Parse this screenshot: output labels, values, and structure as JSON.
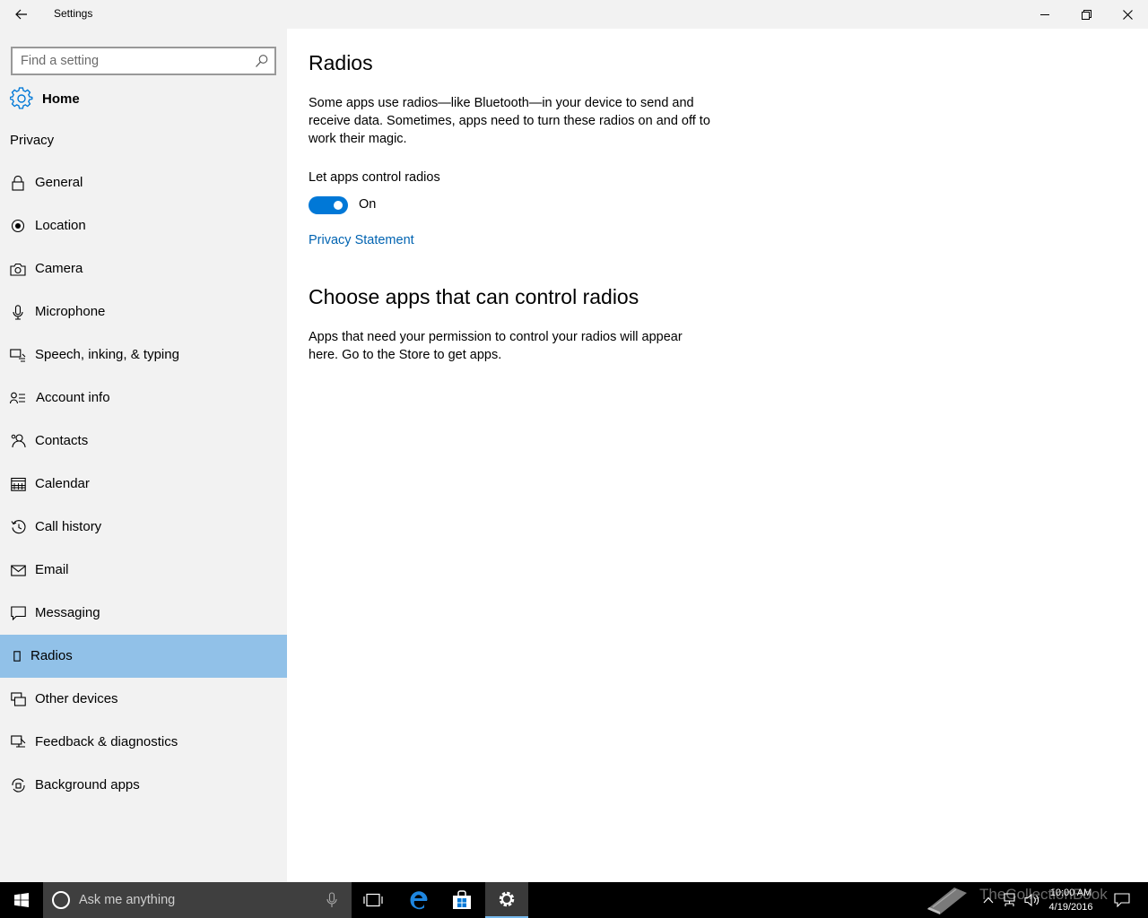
{
  "window": {
    "title": "Settings"
  },
  "sidebar": {
    "search_placeholder": "Find a setting",
    "home_label": "Home",
    "section": "Privacy",
    "items": [
      {
        "label": "General",
        "icon": "lock-icon"
      },
      {
        "label": "Location",
        "icon": "location-icon"
      },
      {
        "label": "Camera",
        "icon": "camera-icon"
      },
      {
        "label": "Microphone",
        "icon": "microphone-icon"
      },
      {
        "label": "Speech, inking, & typing",
        "icon": "speech-icon"
      },
      {
        "label": "Account info",
        "icon": "account-info-icon"
      },
      {
        "label": "Contacts",
        "icon": "contacts-icon"
      },
      {
        "label": "Calendar",
        "icon": "calendar-icon"
      },
      {
        "label": "Call history",
        "icon": "history-icon"
      },
      {
        "label": "Email",
        "icon": "email-icon"
      },
      {
        "label": "Messaging",
        "icon": "messaging-icon"
      },
      {
        "label": "Radios",
        "icon": "radios-icon",
        "selected": true
      },
      {
        "label": "Other devices",
        "icon": "devices-icon"
      },
      {
        "label": "Feedback & diagnostics",
        "icon": "feedback-icon"
      },
      {
        "label": "Background apps",
        "icon": "background-apps-icon"
      }
    ]
  },
  "main": {
    "title": "Radios",
    "description": "Some apps use radios—like Bluetooth—in your device to send and receive data. Sometimes, apps need to turn these radios on and off to work their magic.",
    "toggle_label": "Let apps control radios",
    "toggle_state": "On",
    "toggle_on": true,
    "privacy_link": "Privacy Statement",
    "section_title": "Choose apps that can control radios",
    "section_description": "Apps that need your permission to control your radios will appear here. Go to the Store to get apps."
  },
  "taskbar": {
    "search_text": "Ask me anything",
    "watermark": "TheCollectionBook",
    "time": "10:00 AM",
    "date": "4/19/2016"
  },
  "colors": {
    "accent": "#0078d7",
    "link": "#0063b1",
    "selected_bg": "#91c1e8",
    "sidebar_bg": "#f2f2f2"
  }
}
